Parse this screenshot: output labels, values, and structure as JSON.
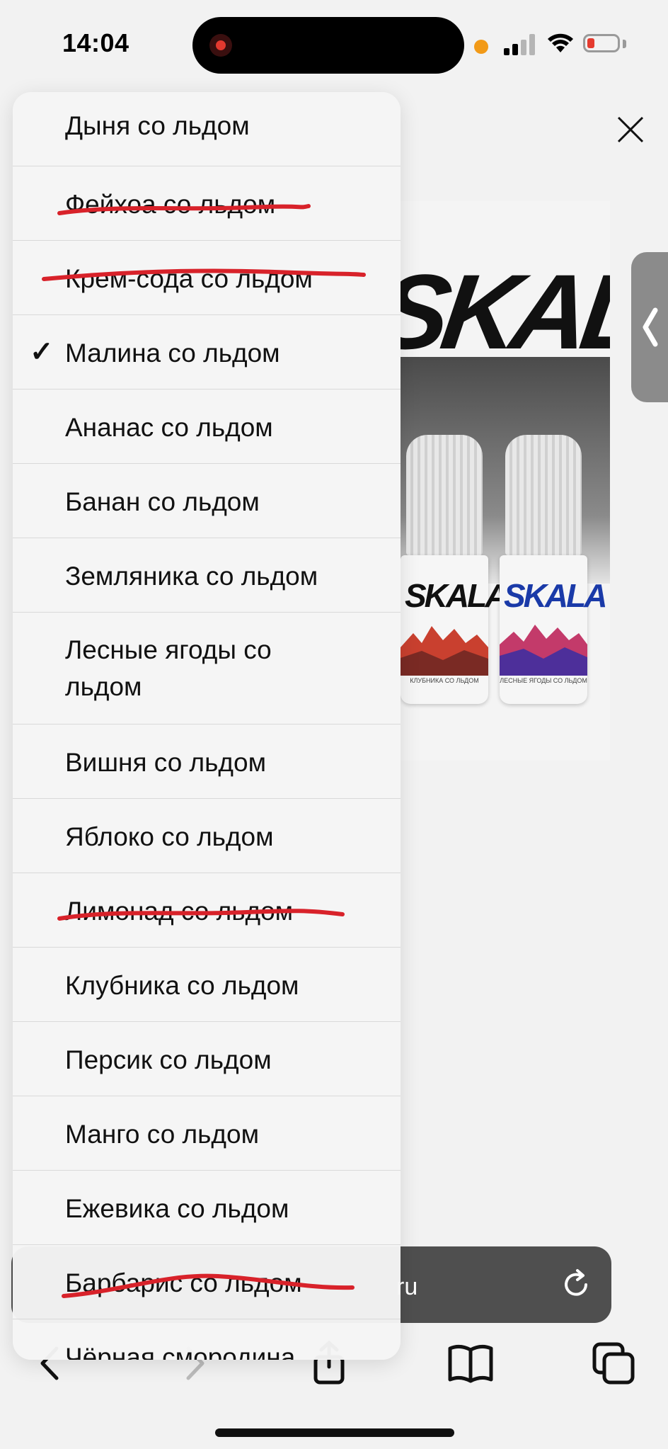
{
  "status_bar": {
    "time": "14:04"
  },
  "page": {
    "product_brand": "SKALA",
    "bottle_left": {
      "logo": "SKALA",
      "label": "КЛУБНИКА СО ЛЬДОМ"
    },
    "bottle_right": {
      "logo": "SKALA",
      "label": "ЛЕСНЫЕ ЯГОДЫ СО ЛЬДОМ"
    }
  },
  "browser": {
    "url_suffix": "ru"
  },
  "menu": {
    "items": [
      {
        "label": "Дыня со льдом"
      },
      {
        "label": "Фейхоа со льдом"
      },
      {
        "label": "Крем-сода со льдом"
      },
      {
        "label": "Малина со льдом",
        "selected": true
      },
      {
        "label": "Ананас со льдом"
      },
      {
        "label": "Банан со льдом"
      },
      {
        "label": "Земляника со льдом"
      },
      {
        "label": "Лесные ягоды со льдом"
      },
      {
        "label": "Вишня со льдом"
      },
      {
        "label": "Яблоко со льдом"
      },
      {
        "label": "Лимонад со льдом"
      },
      {
        "label": "Клубника со льдом"
      },
      {
        "label": "Персик со льдом"
      },
      {
        "label": "Манго со льдом"
      },
      {
        "label": "Ежевика со льдом"
      },
      {
        "label": "Барбарис со льдом"
      },
      {
        "label": "Чёрная смородина"
      }
    ],
    "check_mark": "✓"
  },
  "colors": {
    "strike_annotation": "#d8222a",
    "menu_background": "#f5f5f5"
  }
}
